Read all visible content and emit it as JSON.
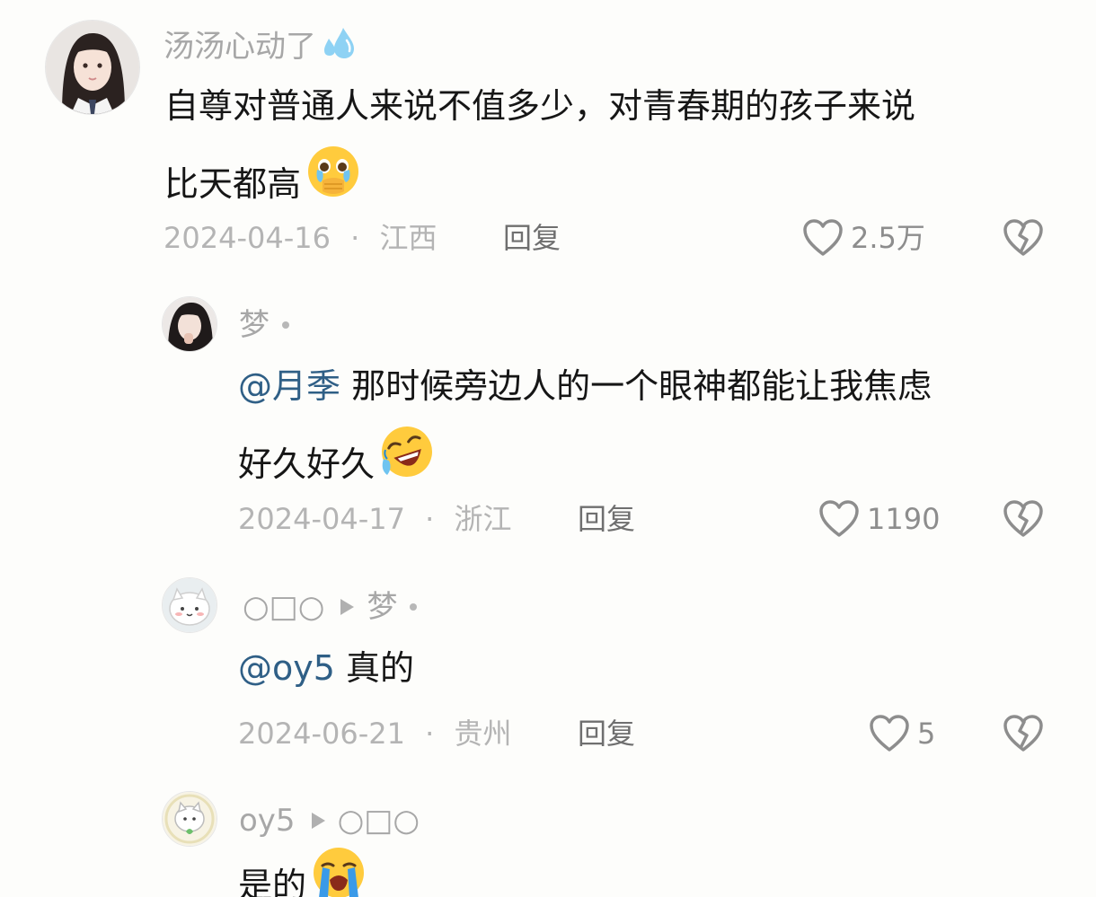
{
  "comments": [
    {
      "username": "汤汤心动了",
      "username_emoji": "droplets-icon",
      "text_line1": "自尊对普通人来说不值多少，对青春期的孩子来说",
      "text_line2": "比天都高",
      "emoji": "crying-covering-mouth-emoji",
      "date": "2024-04-16",
      "location": "江西",
      "reply_label": "回复",
      "likes": "2.5万"
    },
    {
      "username": "梦",
      "mention": "@月季",
      "text_line1": "那时候旁边人的一个眼神都能让我焦虑",
      "text_line2": "好久好久",
      "emoji": "rolling-laughing-emoji",
      "date": "2024-04-17",
      "location": "浙江",
      "reply_label": "回复",
      "likes": "1190"
    },
    {
      "username": "○□○",
      "reply_to": "梦",
      "mention": "@oy5",
      "text_line1": "真的",
      "date": "2024-06-21",
      "location": "贵州",
      "reply_label": "回复",
      "likes": "5"
    },
    {
      "username": "oy5",
      "reply_to": "○□○",
      "text_line1": "是的",
      "emoji": "loudly-crying-emoji"
    }
  ],
  "separator": "·",
  "colors": {
    "background": "#fdfdfb",
    "mention": "#2f5f86",
    "meta": "#b4b4b4",
    "text": "#161616"
  }
}
